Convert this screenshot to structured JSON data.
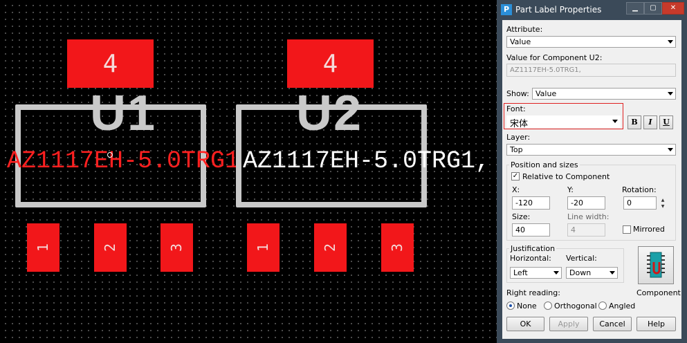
{
  "pcb": {
    "u1": {
      "designator": "U1",
      "value": "AZ1117EH-5.0TRG1",
      "value_color": "#ff2020",
      "pads": {
        "top": "4",
        "bottom": [
          "1",
          "2",
          "3"
        ]
      }
    },
    "u2": {
      "designator": "U2",
      "value": "AZ1117EH-5.0TRG1,",
      "value_color": "#ffffff",
      "pads": {
        "top": "4",
        "bottom": [
          "1",
          "2",
          "3"
        ]
      }
    },
    "colors": {
      "pad": "#f2171a",
      "silkscreen": "#c9c9c9",
      "background": "#000000"
    }
  },
  "dialog": {
    "title": "Part Label Properties",
    "titlebar_buttons": [
      "minimize",
      "maximize",
      "close"
    ],
    "attribute_label": "Attribute:",
    "attribute_value": "Value",
    "value_for_label": "Value for Component U2:",
    "value_for_text": "AZ1117EH-5.0TRG1,",
    "show_label": "Show:",
    "show_value": "Value",
    "font_label": "Font:",
    "font_value": "宋体",
    "bold_label": "B",
    "italic_label": "I",
    "underline_label": "U",
    "layer_label": "Layer:",
    "layer_value": "Top",
    "position_group": "Position and sizes",
    "relative_label": "Relative to Component",
    "relative_checked": true,
    "x_label": "X:",
    "x_value": "-120",
    "y_label": "Y:",
    "y_value": "-20",
    "rotation_label": "Rotation:",
    "rotation_value": "0",
    "size_label": "Size:",
    "size_value": "40",
    "line_width_label": "Line width:",
    "line_width_value": "4",
    "mirrored_label": "Mirrored",
    "mirrored_checked": false,
    "justification_group": "Justification",
    "horizontal_label": "Horizontal:",
    "horizontal_value": "Left",
    "vertical_label": "Vertical:",
    "vertical_value": "Down",
    "component_label": "Component",
    "right_reading_label": "Right reading:",
    "reading_options": [
      "None",
      "Orthogonal",
      "Angled"
    ],
    "reading_selected": "None",
    "ok_label": "OK",
    "apply_label": "Apply",
    "cancel_label": "Cancel",
    "help_label": "Help",
    "highlight_color": "#e02020"
  }
}
